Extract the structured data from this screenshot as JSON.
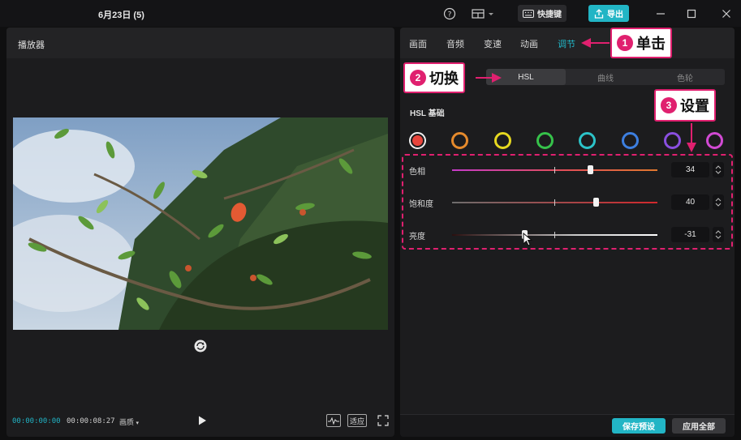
{
  "titlebar": {
    "title": "6月23日 (5)",
    "shortcut_label": "快捷键",
    "export_label": "导出"
  },
  "player": {
    "title": "播放器",
    "time_current": "00:00:00:00",
    "time_total": "00:00:08:27",
    "quality_label": "画质",
    "fit_label": "适应"
  },
  "tabs": [
    {
      "label": "画面"
    },
    {
      "label": "音频"
    },
    {
      "label": "变速"
    },
    {
      "label": "动画"
    },
    {
      "label": "调节"
    }
  ],
  "subtabs": [
    {
      "label": "HSL"
    },
    {
      "label": "曲线"
    },
    {
      "label": "色轮"
    }
  ],
  "hsl": {
    "section_title": "HSL 基础",
    "swatches": [
      {
        "color": "#e8453c",
        "name": "red"
      },
      {
        "color": "#e58a2c",
        "name": "orange"
      },
      {
        "color": "#e6d820",
        "name": "yellow"
      },
      {
        "color": "#36c24a",
        "name": "green"
      },
      {
        "color": "#2cc3c8",
        "name": "cyan"
      },
      {
        "color": "#3d7fe0",
        "name": "blue"
      },
      {
        "color": "#8a4fe0",
        "name": "purple"
      },
      {
        "color": "#d24ad4",
        "name": "magenta"
      }
    ],
    "rows": [
      {
        "label": "色相",
        "value": "34",
        "level": 0.67,
        "track": "linear-gradient(90deg,#c63bc9,#e24f57 55%,#e0782e)"
      },
      {
        "label": "饱和度",
        "value": "40",
        "level": 0.7,
        "track": "linear-gradient(90deg,#6d6d6d,#d2282c)"
      },
      {
        "label": "亮度",
        "value": "-31",
        "level": 0.35,
        "track": "linear-gradient(90deg,#2a0f0f,#c9c9c9 60%,#ffffff)"
      }
    ]
  },
  "footer": {
    "save_label": "保存预设",
    "apply_label": "应用全部"
  },
  "annotations": {
    "click": {
      "num": "1",
      "text": "单击"
    },
    "switch": {
      "num": "2",
      "text": "切换"
    },
    "set": {
      "num": "3",
      "text": "设置"
    },
    "accent_color": "#e0206f"
  }
}
